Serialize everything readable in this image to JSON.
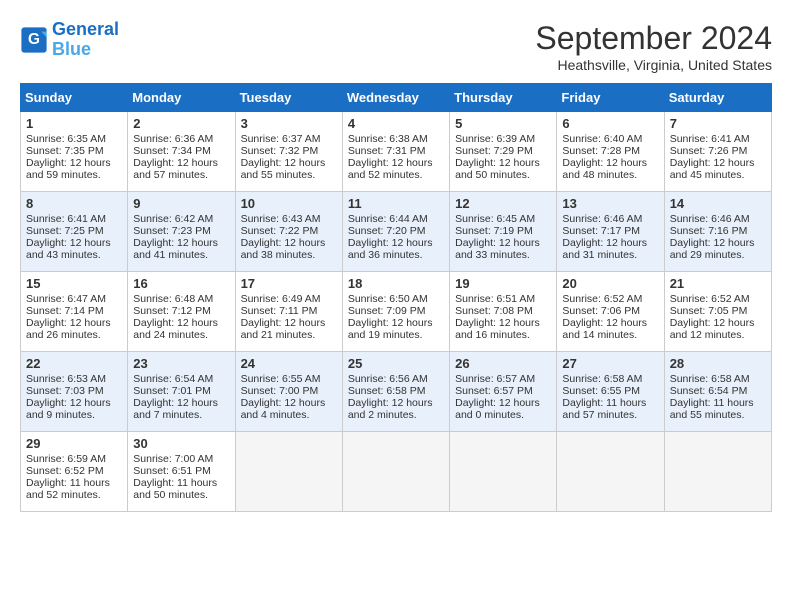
{
  "header": {
    "logo_line1": "General",
    "logo_line2": "Blue",
    "title": "September 2024",
    "subtitle": "Heathsville, Virginia, United States"
  },
  "weekdays": [
    "Sunday",
    "Monday",
    "Tuesday",
    "Wednesday",
    "Thursday",
    "Friday",
    "Saturday"
  ],
  "weeks": [
    [
      {
        "day": "1",
        "info": "Sunrise: 6:35 AM\nSunset: 7:35 PM\nDaylight: 12 hours\nand 59 minutes."
      },
      {
        "day": "2",
        "info": "Sunrise: 6:36 AM\nSunset: 7:34 PM\nDaylight: 12 hours\nand 57 minutes."
      },
      {
        "day": "3",
        "info": "Sunrise: 6:37 AM\nSunset: 7:32 PM\nDaylight: 12 hours\nand 55 minutes."
      },
      {
        "day": "4",
        "info": "Sunrise: 6:38 AM\nSunset: 7:31 PM\nDaylight: 12 hours\nand 52 minutes."
      },
      {
        "day": "5",
        "info": "Sunrise: 6:39 AM\nSunset: 7:29 PM\nDaylight: 12 hours\nand 50 minutes."
      },
      {
        "day": "6",
        "info": "Sunrise: 6:40 AM\nSunset: 7:28 PM\nDaylight: 12 hours\nand 48 minutes."
      },
      {
        "day": "7",
        "info": "Sunrise: 6:41 AM\nSunset: 7:26 PM\nDaylight: 12 hours\nand 45 minutes."
      }
    ],
    [
      {
        "day": "8",
        "info": "Sunrise: 6:41 AM\nSunset: 7:25 PM\nDaylight: 12 hours\nand 43 minutes."
      },
      {
        "day": "9",
        "info": "Sunrise: 6:42 AM\nSunset: 7:23 PM\nDaylight: 12 hours\nand 41 minutes."
      },
      {
        "day": "10",
        "info": "Sunrise: 6:43 AM\nSunset: 7:22 PM\nDaylight: 12 hours\nand 38 minutes."
      },
      {
        "day": "11",
        "info": "Sunrise: 6:44 AM\nSunset: 7:20 PM\nDaylight: 12 hours\nand 36 minutes."
      },
      {
        "day": "12",
        "info": "Sunrise: 6:45 AM\nSunset: 7:19 PM\nDaylight: 12 hours\nand 33 minutes."
      },
      {
        "day": "13",
        "info": "Sunrise: 6:46 AM\nSunset: 7:17 PM\nDaylight: 12 hours\nand 31 minutes."
      },
      {
        "day": "14",
        "info": "Sunrise: 6:46 AM\nSunset: 7:16 PM\nDaylight: 12 hours\nand 29 minutes."
      }
    ],
    [
      {
        "day": "15",
        "info": "Sunrise: 6:47 AM\nSunset: 7:14 PM\nDaylight: 12 hours\nand 26 minutes."
      },
      {
        "day": "16",
        "info": "Sunrise: 6:48 AM\nSunset: 7:12 PM\nDaylight: 12 hours\nand 24 minutes."
      },
      {
        "day": "17",
        "info": "Sunrise: 6:49 AM\nSunset: 7:11 PM\nDaylight: 12 hours\nand 21 minutes."
      },
      {
        "day": "18",
        "info": "Sunrise: 6:50 AM\nSunset: 7:09 PM\nDaylight: 12 hours\nand 19 minutes."
      },
      {
        "day": "19",
        "info": "Sunrise: 6:51 AM\nSunset: 7:08 PM\nDaylight: 12 hours\nand 16 minutes."
      },
      {
        "day": "20",
        "info": "Sunrise: 6:52 AM\nSunset: 7:06 PM\nDaylight: 12 hours\nand 14 minutes."
      },
      {
        "day": "21",
        "info": "Sunrise: 6:52 AM\nSunset: 7:05 PM\nDaylight: 12 hours\nand 12 minutes."
      }
    ],
    [
      {
        "day": "22",
        "info": "Sunrise: 6:53 AM\nSunset: 7:03 PM\nDaylight: 12 hours\nand 9 minutes."
      },
      {
        "day": "23",
        "info": "Sunrise: 6:54 AM\nSunset: 7:01 PM\nDaylight: 12 hours\nand 7 minutes."
      },
      {
        "day": "24",
        "info": "Sunrise: 6:55 AM\nSunset: 7:00 PM\nDaylight: 12 hours\nand 4 minutes."
      },
      {
        "day": "25",
        "info": "Sunrise: 6:56 AM\nSunset: 6:58 PM\nDaylight: 12 hours\nand 2 minutes."
      },
      {
        "day": "26",
        "info": "Sunrise: 6:57 AM\nSunset: 6:57 PM\nDaylight: 12 hours\nand 0 minutes."
      },
      {
        "day": "27",
        "info": "Sunrise: 6:58 AM\nSunset: 6:55 PM\nDaylight: 11 hours\nand 57 minutes."
      },
      {
        "day": "28",
        "info": "Sunrise: 6:58 AM\nSunset: 6:54 PM\nDaylight: 11 hours\nand 55 minutes."
      }
    ],
    [
      {
        "day": "29",
        "info": "Sunrise: 6:59 AM\nSunset: 6:52 PM\nDaylight: 11 hours\nand 52 minutes."
      },
      {
        "day": "30",
        "info": "Sunrise: 7:00 AM\nSunset: 6:51 PM\nDaylight: 11 hours\nand 50 minutes."
      },
      {
        "day": "",
        "info": ""
      },
      {
        "day": "",
        "info": ""
      },
      {
        "day": "",
        "info": ""
      },
      {
        "day": "",
        "info": ""
      },
      {
        "day": "",
        "info": ""
      }
    ]
  ]
}
